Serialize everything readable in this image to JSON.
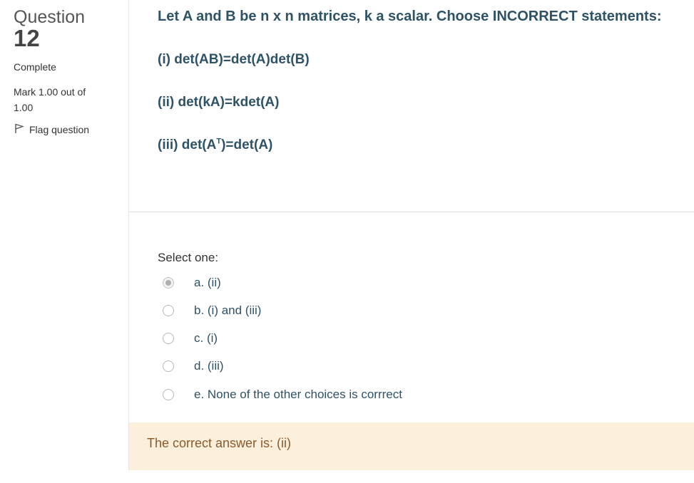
{
  "info": {
    "question_label": "Question",
    "question_number": "12",
    "state": "Complete",
    "grade": "Mark 1.00 out of 1.00",
    "flag_label": "Flag question"
  },
  "question": {
    "text": "Let A and B be n x n matrices, k a scalar. Choose INCORRECT statements:",
    "statements": [
      {
        "prefix": "(i) det(AB)=det(A)det(B)"
      },
      {
        "prefix": "(ii) det(kA)=kdet(A)"
      },
      {
        "prefix": "(iii) det(A",
        "sup": "T",
        "suffix": ")=det(A)"
      }
    ]
  },
  "answer": {
    "prompt": "Select one:",
    "options": [
      {
        "label": "a. (ii)",
        "selected": true
      },
      {
        "label": "b. (i) and (iii)",
        "selected": false
      },
      {
        "label": "c. (i)",
        "selected": false
      },
      {
        "label": "d. (iii)",
        "selected": false
      },
      {
        "label": "e. None of the other choices is corrrect",
        "selected": false
      }
    ]
  },
  "feedback": {
    "right_answer": "The correct answer is: (ii)"
  }
}
